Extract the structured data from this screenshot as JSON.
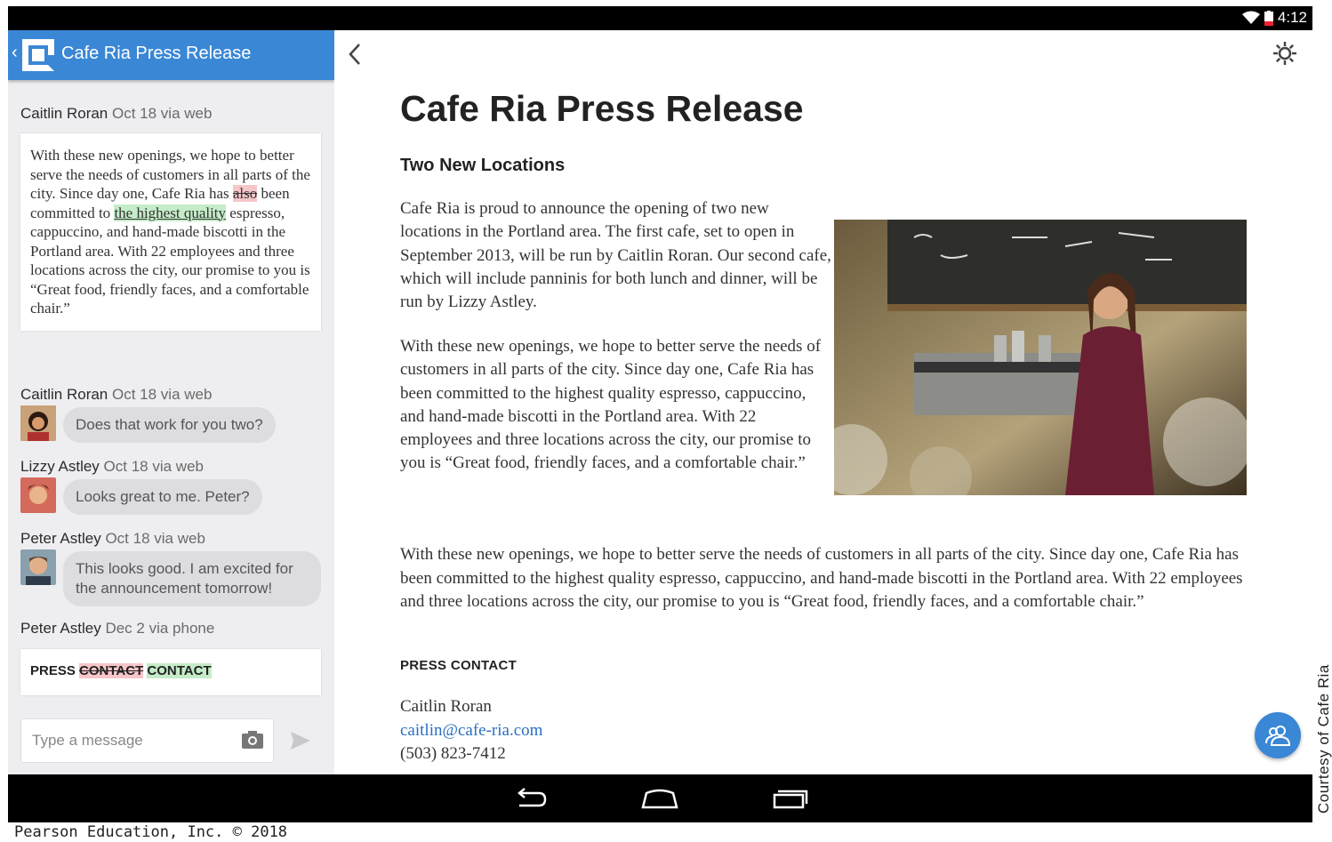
{
  "status": {
    "time": "4:12"
  },
  "left": {
    "header_title": "Cafe Ria Press Release",
    "messages": [
      {
        "author": "Caitlin Roran",
        "meta": "Oct 18 via web"
      },
      {
        "author": "Caitlin Roran",
        "meta": "Oct 18 via web",
        "text": "Does that work for you two?"
      },
      {
        "author": "Lizzy Astley",
        "meta": "Oct 18 via web",
        "text": "Looks great to me. Peter?"
      },
      {
        "author": "Peter Astley",
        "meta": "Oct 18 via web",
        "text": "This looks good. I am excited for the announcement tomorrow!"
      },
      {
        "author": "Peter Astley",
        "meta": "Dec 2 via phone"
      }
    ],
    "edit1": {
      "p1": "With these new openings, we hope to better serve the needs of customers in all parts of the city. Since day one, Cafe Ria has",
      "deleted": "also",
      "p2": "been committed to",
      "inserted": "the highest quality",
      "p3": "espresso, cappuccino, and hand-made biscotti in the Portland area. With 22 employees and three locations across the city, our promise to you is “Great food, friendly faces, and a comfortable chair.”"
    },
    "edit2": {
      "prefix": "PRESS",
      "deleted": "CONTACT",
      "inserted": "CONTACT"
    },
    "input_placeholder": "Type a message"
  },
  "doc": {
    "title": "Cafe Ria Press Release",
    "subtitle": "Two New Locations",
    "para1": "Cafe Ria is proud to announce the opening of two new locations in the Portland area. The first cafe, set to open in September 2013, will be run by Caitlin Roran. Our second cafe, which will include panninis for both lunch and dinner, will be run by Lizzy Astley.",
    "para2": "With these new openings, we hope to better serve the needs of customers in all parts of the city. Since day one, Cafe Ria has been committed to the highest quality espresso, cappuccino, and hand-made biscotti in the Portland area. With 22 employees and three locations across the city, our promise to you is “Great food, friendly faces, and a comfortable chair.”",
    "para3": "With these new openings, we hope to better serve the needs of customers in all parts of the city. Since day one, Cafe Ria has been committed to the highest quality espresso, cappuccino, and hand-made biscotti in the Portland area. With 22 employees and three locations across the city, our promise to you is “Great food, friendly faces, and a comfortable chair.”",
    "press_contact_label": "PRESS CONTACT",
    "contact_name": "Caitlin Roran",
    "contact_email": "caitlin@cafe-ria.com",
    "contact_phone": "(503) 823-7412"
  },
  "credit": "Courtesy of Cafe Ria",
  "copyright": "Pearson Education, Inc. © 2018",
  "colors": {
    "accent": "#3a87d6",
    "deleted_bg": "#f6c6c9",
    "inserted_bg": "#c5ecc8",
    "link": "#2a6fc1"
  }
}
